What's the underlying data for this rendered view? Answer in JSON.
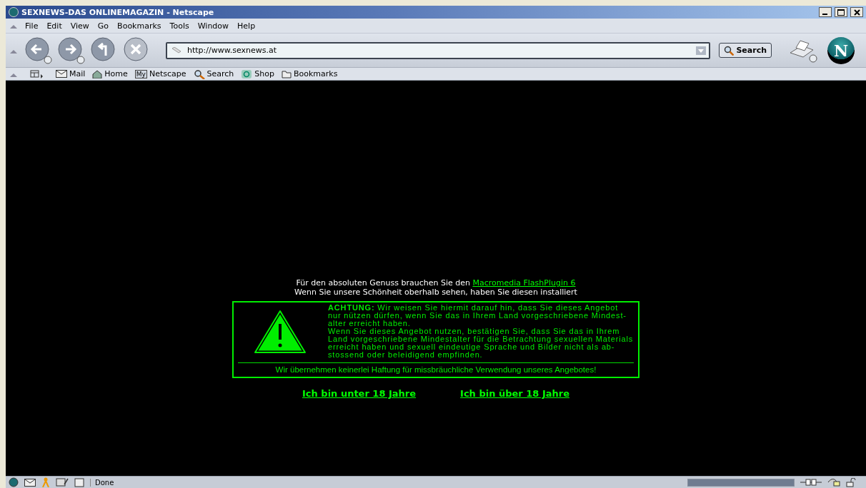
{
  "window": {
    "title": "SEXNEWS-DAS ONLINEMAGAZIN - Netscape"
  },
  "menu": [
    "File",
    "Edit",
    "View",
    "Go",
    "Bookmarks",
    "Tools",
    "Window",
    "Help"
  ],
  "navigation": {
    "url": "http://www.sexnews.at",
    "search_button": "Search",
    "throbber_letter": "N"
  },
  "personal_toolbar": [
    {
      "kind": "mail",
      "label": "Mail"
    },
    {
      "kind": "home",
      "label": "Home"
    },
    {
      "kind": "my",
      "badge": "My",
      "label": "Netscape"
    },
    {
      "kind": "search",
      "label": "Search"
    },
    {
      "kind": "shop",
      "label": "Shop"
    },
    {
      "kind": "bookmarks",
      "label": "Bookmarks"
    }
  ],
  "page": {
    "plugin_line": {
      "text": "Für den absoluten Genuss brauchen Sie den ",
      "link": "Macromedia FlashPlugin 6"
    },
    "installed_line": "Wenn Sie unsere Schönheit oberhalb sehen, haben Sie diesen installiert",
    "warning": {
      "lines": [
        "**ACHTUNG:** Wir weisen Sie hiermit darauf hin, dass Sie dieses Angebot",
        "nur nützen dürfen, wenn Sie das in Ihrem Land vorgeschriebene Mindest-",
        "alter erreicht haben.",
        "Wenn Sie dieses Angebot nutzen, bestätigen Sie, dass Sie das in Ihrem",
        "Land vorgeschriebene Mindestalter für die Betrachtung sexuellen Materials",
        "erreicht haben und sexuell eindeutige Sprache und Bilder nicht als ab-",
        "stossend oder beleidigend empfinden."
      ],
      "disclaimer": "Wir übernehmen keinerlei Haftung für missbräuchliche Verwendung unseres Angebotes!"
    },
    "links": [
      "Ich bin unter 18 Jahre",
      "Ich bin über 18 Jahre"
    ]
  },
  "status_bar": {
    "text": "Done",
    "progress": {
      "level": 1
    }
  }
}
